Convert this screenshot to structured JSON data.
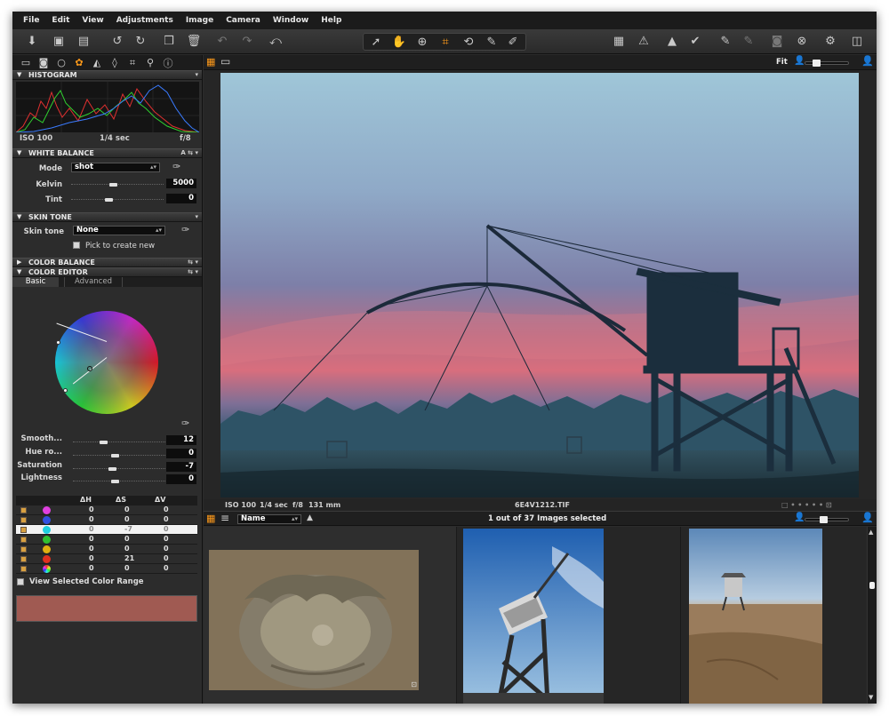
{
  "menu": [
    "File",
    "Edit",
    "View",
    "Adjustments",
    "Image",
    "Camera",
    "Window",
    "Help"
  ],
  "toolbar": {
    "left_icons": [
      "import-icon",
      "capture-icon",
      "export-icon",
      "rotate-left-icon",
      "rotate-right-icon",
      "new-folder-icon",
      "trash-icon",
      "undo-icon",
      "redo-icon",
      "reset-icon"
    ],
    "cursor_tools": [
      "select-icon",
      "pan-icon",
      "zoom-icon",
      "crop-icon",
      "rotate-icon",
      "picker-icon",
      "adjust-icon"
    ],
    "right_icons": [
      "grid-icon",
      "warning-icon",
      "copy-adj-icon",
      "apply-adj-icon",
      "edit-icon",
      "process-icon",
      "camera-icon",
      "close-circle-icon",
      "settings-icon",
      "workspace-icon"
    ]
  },
  "tool_tabs": [
    "folder-icon",
    "camera-tab-icon",
    "search-tab-icon",
    "color-tab-icon",
    "exposure-tab-icon",
    "lens-tab-icon",
    "crop-tab-icon",
    "focus-tab-icon",
    "info-tab-icon"
  ],
  "histogram": {
    "title": "HISTOGRAM",
    "iso": "ISO 100",
    "shutter": "1/4 sec",
    "aperture": "f/8"
  },
  "white_balance": {
    "title": "WHITE BALANCE",
    "badge": "A",
    "mode_label": "Mode",
    "mode_value": "shot",
    "kelvin_label": "Kelvin",
    "kelvin_value": "5000",
    "kelvin_level": 0.45,
    "tint_label": "Tint",
    "tint_value": "0",
    "tint_level": 0.4
  },
  "skin_tone": {
    "title": "SKIN TONE",
    "label": "Skin tone",
    "value": "None",
    "pick_label": "Pick to create new"
  },
  "color_balance": {
    "title": "COLOR BALANCE"
  },
  "color_editor": {
    "title": "COLOR EDITOR",
    "tabs": [
      "Basic",
      "Advanced"
    ],
    "sliders": [
      {
        "label": "Smooth...",
        "value": "12",
        "level": 0.32
      },
      {
        "label": "Hue ro...",
        "value": "0",
        "level": 0.45
      },
      {
        "label": "Saturation",
        "value": "-7",
        "level": 0.42
      },
      {
        "label": "Lightness",
        "value": "0",
        "level": 0.45
      }
    ],
    "table_headers": [
      "ΔH",
      "ΔS",
      "ΔV"
    ],
    "rows": [
      {
        "color": "#e040e0",
        "dh": "0",
        "ds": "0",
        "dv": "0",
        "selected": false
      },
      {
        "color": "#3050e0",
        "dh": "0",
        "ds": "0",
        "dv": "0",
        "selected": false
      },
      {
        "color": "#20d0e0",
        "dh": "0",
        "ds": "-7",
        "dv": "0",
        "selected": true
      },
      {
        "color": "#30c030",
        "dh": "0",
        "ds": "0",
        "dv": "0",
        "selected": false
      },
      {
        "color": "#e0b010",
        "dh": "0",
        "ds": "0",
        "dv": "0",
        "selected": false
      },
      {
        "color": "#e03020",
        "dh": "0",
        "ds": "21",
        "dv": "0",
        "selected": false
      },
      {
        "color": "multicolor",
        "dh": "0",
        "ds": "0",
        "dv": "0",
        "selected": false
      }
    ],
    "view_range_label": "View Selected Color Range",
    "swatch_color": "#a05a52"
  },
  "viewer": {
    "zoom": "Fit",
    "info_iso": "ISO 100",
    "info_shutter": "1/4 sec",
    "info_aperture": "f/8",
    "info_focal": "131 mm",
    "filename": "6E4V1212.TIF"
  },
  "browser": {
    "sort_label": "Name",
    "status": "1 out of 37 Images selected"
  }
}
